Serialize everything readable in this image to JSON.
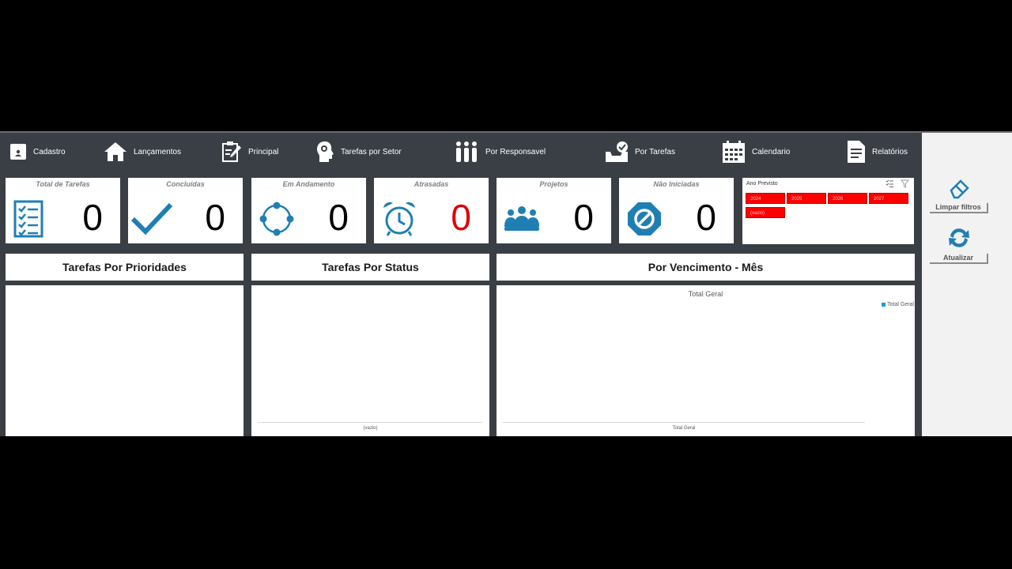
{
  "nav": {
    "items": [
      {
        "label": "Cadastro",
        "icon": "user-badge-icon"
      },
      {
        "label": "Lançamentos",
        "icon": "home-icon"
      },
      {
        "label": "Principal",
        "icon": "edit-document-icon"
      },
      {
        "label": "Tarefas por Setor",
        "icon": "idea-head-icon"
      },
      {
        "label": "Por Responsavel",
        "icon": "people-group-icon"
      },
      {
        "label": "Por Tarefas",
        "icon": "inbox-check-icon"
      },
      {
        "label": "Calendario",
        "icon": "calendar-icon"
      },
      {
        "label": "Relatórios",
        "icon": "report-document-icon"
      }
    ]
  },
  "cards": [
    {
      "title": "Total de Tarefas",
      "value": "0",
      "icon": "checklist-icon"
    },
    {
      "title": "Concluídas",
      "value": "0",
      "icon": "checkmark-icon"
    },
    {
      "title": "Em Andamento",
      "value": "0",
      "icon": "progress-circle-icon"
    },
    {
      "title": "Atrasadas",
      "value": "0",
      "icon": "alarm-clock-icon",
      "value_color": "#e00000"
    },
    {
      "title": "Projetos",
      "value": "0",
      "icon": "team-icon"
    },
    {
      "title": "Não Iniciadas",
      "value": "0",
      "icon": "block-icon"
    }
  ],
  "slicer": {
    "title": "Ano Previsto",
    "items": [
      "2024",
      "2025",
      "2026",
      "2027",
      "(vazio)"
    ],
    "tools": [
      "multi-select-icon",
      "clear-filter-icon"
    ]
  },
  "sections": {
    "prioridades": "Tarefas Por Prioridades",
    "status": "Tarefas Por Status",
    "vencimento": "Por Vencimento - Mês"
  },
  "status_chart": {
    "x_label": "(vazio)"
  },
  "vencimento_chart": {
    "title": "Total Geral",
    "legend": "Total Geral",
    "x_label": "Total Geral"
  },
  "side": {
    "clear_label": "Limpar filtros",
    "refresh_label": "Atualizar"
  },
  "colors": {
    "accent": "#1f7fb3",
    "dark": "#3a3f45",
    "alert": "#e00000"
  }
}
